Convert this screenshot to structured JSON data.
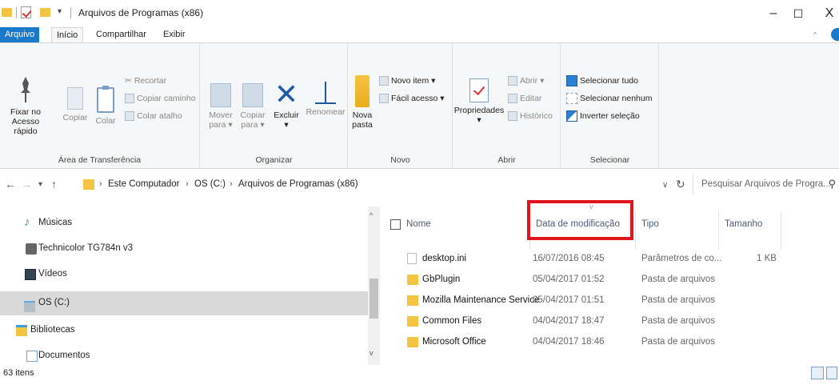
{
  "window": {
    "title": "Arquivos de Programas (x86)",
    "minimize": "–",
    "maximize": "☐",
    "close": "X"
  },
  "ribbon_tabs": [
    "Arquivo",
    "Início",
    "Compartilhar",
    "Exibir"
  ],
  "ribbon": {
    "groups": {
      "clipboard": "Área de Transferência",
      "organize": "Organizar",
      "new": "Novo",
      "open": "Abrir",
      "select": "Selecionar"
    },
    "pin_line1": "Fixar no",
    "pin_line2": "Acesso rápido",
    "copy": "Copiar",
    "paste": "Colar",
    "cut": "Recortar",
    "copy_path": "Copiar caminho",
    "paste_shortcut": "Colar atalho",
    "move_line1": "Mover",
    "move_line2": "para ▾",
    "copy_to_line1": "Copiar",
    "copy_to_line2": "para ▾",
    "delete": "Excluir",
    "delete_arrow": "▾",
    "rename": "Renomear",
    "new_folder_line1": "Nova",
    "new_folder_line2": "pasta",
    "new_item": "Novo item ▾",
    "easy_access": "Fácil acesso ▾",
    "properties": "Propriedades",
    "properties_arrow": "▾",
    "open": "Abrir ▾",
    "edit": "Editar",
    "history": "Histórico",
    "select_all": "Selecionar tudo",
    "select_none": "Selecionar nenhum",
    "invert_selection": "Inverter seleção"
  },
  "address": {
    "breadcrumb": [
      "Este Computador",
      "OS (C:)",
      "Arquivos de Programas (x86)"
    ],
    "search_placeholder": "Pesquisar Arquivos de Progra..."
  },
  "nav_pane": [
    {
      "label": "Músicas",
      "icon": "music-icon"
    },
    {
      "label": "Technicolor TG784n v3",
      "icon": "router-icon"
    },
    {
      "label": "Vídeos",
      "icon": "video-icon"
    },
    {
      "label": "OS (C:)",
      "icon": "drive-icon",
      "selected": true
    },
    {
      "label": "Bibliotecas",
      "icon": "library-icon"
    },
    {
      "label": "Documentos",
      "icon": "documents-icon"
    }
  ],
  "columns": [
    "Nome",
    "Data de modificação",
    "Tipo",
    "Tamanho"
  ],
  "files": [
    {
      "name": "desktop.ini",
      "date": "16/07/2016 08:45",
      "type": "Parâmetros de co...",
      "size": "1 KB",
      "icon": "file-icon"
    },
    {
      "name": "GbPlugin",
      "date": "05/04/2017 01:52",
      "type": "Pasta de arquivos",
      "size": "",
      "icon": "folder-icon"
    },
    {
      "name": "Mozilla Maintenance Service",
      "date": "05/04/2017 01:51",
      "type": "Pasta de arquivos",
      "size": "",
      "icon": "folder-icon"
    },
    {
      "name": "Common Files",
      "date": "04/04/2017 18:47",
      "type": "Pasta de arquivos",
      "size": "",
      "icon": "folder-icon"
    },
    {
      "name": "Microsoft Office",
      "date": "04/04/2017 18:46",
      "type": "Pasta de arquivos",
      "size": "",
      "icon": "folder-icon"
    }
  ],
  "status": {
    "item_count": "63 itens"
  },
  "colors": {
    "accent": "#1979ca",
    "highlight_box": "#e1141b",
    "folder": "#f5c342"
  }
}
